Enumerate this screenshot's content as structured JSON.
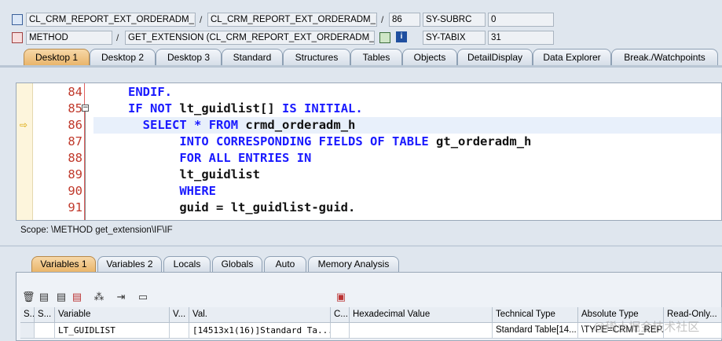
{
  "header": {
    "row1": {
      "class_field": "CL_CRM_REPORT_EXT_ORDERADM_H=...",
      "include_field": "CL_CRM_REPORT_EXT_ORDERADM_H=...",
      "line_field": "86",
      "sysvar1_name": "SY-SUBRC",
      "sysvar1_value": "0"
    },
    "row2": {
      "type_field": "METHOD",
      "method_field": "GET_EXTENSION (CL_CRM_REPORT_EXT_ORDERADM_...",
      "sysvar2_name": "SY-TABIX",
      "sysvar2_value": "31"
    },
    "sep": "/"
  },
  "tabs": [
    "Desktop 1",
    "Desktop 2",
    "Desktop 3",
    "Standard",
    "Structures",
    "Tables",
    "Objects",
    "DetailDisplay",
    "Data Explorer",
    "Break./Watchpoints"
  ],
  "code": {
    "lines": [
      {
        "num": "84",
        "text": "ENDIF."
      },
      {
        "num": "85",
        "text": "IF NOT lt_guidlist[] IS INITIAL."
      },
      {
        "num": "86",
        "text": "  SELECT * FROM crmd_orderadm_h"
      },
      {
        "num": "87",
        "text": "       INTO CORRESPONDING FIELDS OF TABLE gt_orderadm_h"
      },
      {
        "num": "88",
        "text": "       FOR ALL ENTRIES IN"
      },
      {
        "num": "89",
        "text": "       lt_guidlist"
      },
      {
        "num": "90",
        "text": "       WHERE"
      },
      {
        "num": "91",
        "text": "       guid = lt_guidlist-guid."
      }
    ],
    "current_line": "86"
  },
  "scope": "Scope: \\METHOD get_extension\\IF\\IF",
  "var_tabs": [
    "Variables 1",
    "Variables 2",
    "Locals",
    "Globals",
    "Auto",
    "Memory Analysis"
  ],
  "grid": {
    "headers": [
      "S...",
      "Variable",
      "V...",
      "Val.",
      "C...",
      "Hexadecimal Value",
      "Technical Type",
      "Absolute Type",
      "Read-Only..."
    ],
    "row": {
      "s": "",
      "variable": "LT_GUIDLIST",
      "v": "",
      "val": "[14513x1(16)]Standard Ta...",
      "c": "",
      "hex": "",
      "technical_type": "Standard Table[14...",
      "absolute_type": "\\TYPE=CRMT_REP..."
    }
  },
  "watermark": "@稀土掘金技术社区",
  "colors": {
    "keyword": "#1a1aff",
    "line_number": "#c0392b",
    "active_tab": "#e9b56b"
  }
}
